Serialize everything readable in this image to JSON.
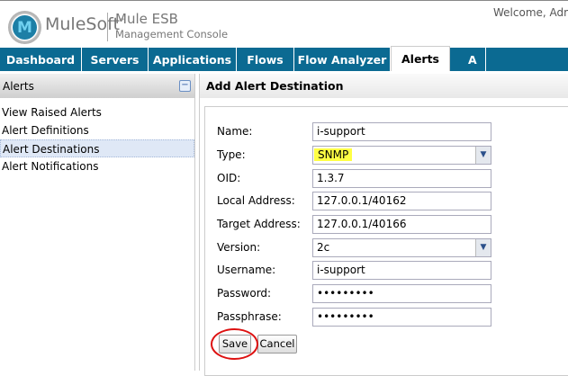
{
  "header": {
    "brand": "MuleSoft",
    "trademark": "™",
    "product": "Mule ESB",
    "product_sub": "Management Console",
    "welcome": "Welcome, Adm"
  },
  "nav": {
    "tabs": [
      {
        "label": "Dashboard"
      },
      {
        "label": "Servers"
      },
      {
        "label": "Applications"
      },
      {
        "label": "Flows"
      },
      {
        "label": "Flow Analyzer"
      },
      {
        "label": "Alerts",
        "active": true
      },
      {
        "label": "A"
      }
    ]
  },
  "sidebar": {
    "title": "Alerts",
    "collapse": "−",
    "items": [
      {
        "label": "View Raised Alerts"
      },
      {
        "label": "Alert Definitions"
      },
      {
        "label": "Alert Destinations",
        "selected": true
      },
      {
        "label": "Alert Notifications"
      }
    ]
  },
  "main": {
    "title": "Add Alert Destination",
    "form": {
      "name": {
        "label": "Name:",
        "value": "i-support"
      },
      "type": {
        "label": "Type:",
        "value": "SNMP"
      },
      "oid": {
        "label": "OID:",
        "value": "1.3.7"
      },
      "local": {
        "label": "Local Address:",
        "value": "127.0.0.1/40162"
      },
      "target": {
        "label": "Target Address:",
        "value": "127.0.0.1/40166"
      },
      "version": {
        "label": "Version:",
        "value": "2c"
      },
      "username": {
        "label": "Username:",
        "value": "i-support"
      },
      "password": {
        "label": "Password:",
        "value": "•••••••••"
      },
      "passphrase": {
        "label": "Passphrase:",
        "value": "•••••••••"
      }
    },
    "save": "Save",
    "cancel": "Cancel"
  },
  "colors": {
    "nav": "#0b6a92",
    "highlight": "#ffff44",
    "annotation": "#dd1111"
  }
}
